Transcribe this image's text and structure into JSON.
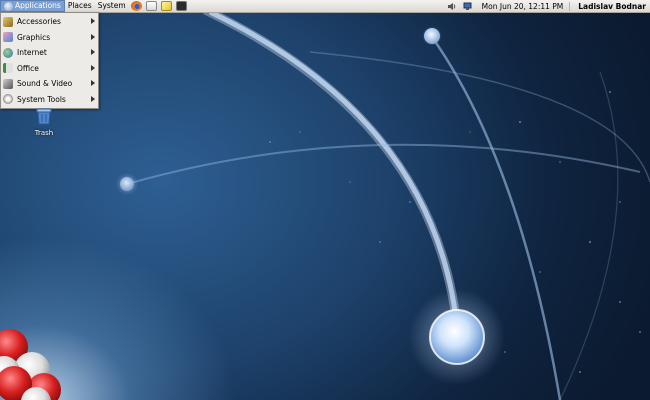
{
  "top_panel": {
    "menus": [
      {
        "label": "Applications",
        "active": true
      },
      {
        "label": "Places",
        "active": false
      },
      {
        "label": "System",
        "active": false
      }
    ],
    "launchers": [
      {
        "icon": "firefox-icon"
      },
      {
        "icon": "mail-icon"
      },
      {
        "icon": "notes-icon"
      },
      {
        "icon": "terminal-icon"
      }
    ],
    "tray": [
      {
        "icon": "volume-icon"
      },
      {
        "icon": "network-icon"
      }
    ],
    "clock": "Mon Jun 20, 12:11 PM",
    "user": "Ladislav Bodnar"
  },
  "applications_menu": {
    "items": [
      {
        "label": "Accessories",
        "icon": "accessories-icon"
      },
      {
        "label": "Graphics",
        "icon": "graphics-icon"
      },
      {
        "label": "Internet",
        "icon": "internet-icon"
      },
      {
        "label": "Office",
        "icon": "office-icon"
      },
      {
        "label": "Sound & Video",
        "icon": "sound-video-icon"
      },
      {
        "label": "System Tools",
        "icon": "system-tools-icon"
      }
    ]
  },
  "desktop": {
    "icons": [
      {
        "label": "Trash",
        "icon": "trash-icon"
      }
    ]
  },
  "colors": {
    "panel": "#dcd9d3",
    "menu_highlight": "#7b9fd1",
    "wallpaper_dark": "#0b1a2e",
    "wallpaper_light": "#2e5f93"
  }
}
